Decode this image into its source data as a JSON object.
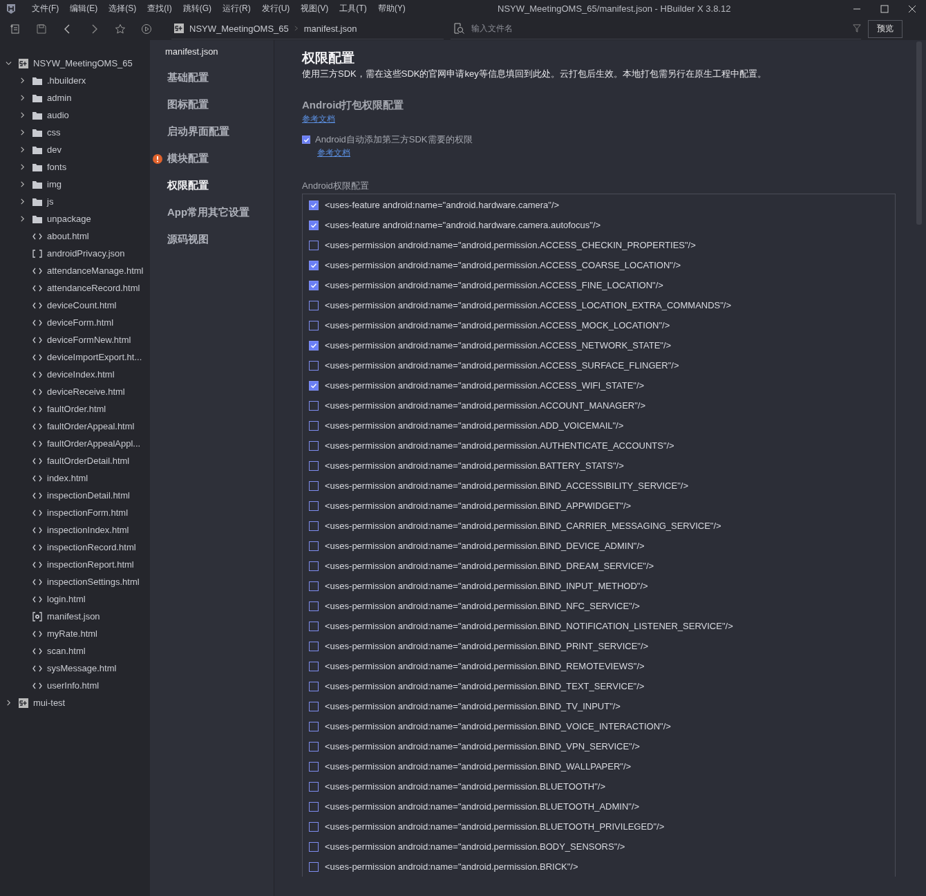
{
  "window": {
    "title": "NSYW_MeetingOMS_65/manifest.json - HBuilder X 3.8.12"
  },
  "menu": [
    "文件(F)",
    "编辑(E)",
    "选择(S)",
    "查找(I)",
    "跳转(G)",
    "运行(R)",
    "发行(U)",
    "视图(V)",
    "工具(T)",
    "帮助(Y)"
  ],
  "breadcrumb": [
    "NSYW_MeetingOMS_65",
    "manifest.json"
  ],
  "search": {
    "placeholder": "输入文件名"
  },
  "preview_button": "预览",
  "tree": [
    {
      "kind": "project",
      "name": "NSYW_MeetingOMS_65",
      "expanded": true,
      "children": [
        {
          "kind": "folder",
          "name": ".hbuilderx",
          "expanded": false
        },
        {
          "kind": "folder",
          "name": "admin",
          "expanded": false
        },
        {
          "kind": "folder",
          "name": "audio",
          "expanded": false
        },
        {
          "kind": "folder",
          "name": "css",
          "expanded": false
        },
        {
          "kind": "folder",
          "name": "dev",
          "expanded": false
        },
        {
          "kind": "folder",
          "name": "fonts",
          "expanded": false
        },
        {
          "kind": "folder",
          "name": "img",
          "expanded": false
        },
        {
          "kind": "folder",
          "name": "js",
          "expanded": false
        },
        {
          "kind": "folder",
          "name": "unpackage",
          "expanded": false
        },
        {
          "kind": "html",
          "name": "about.html"
        },
        {
          "kind": "json",
          "name": "androidPrivacy.json"
        },
        {
          "kind": "html",
          "name": "attendanceManage.html"
        },
        {
          "kind": "html",
          "name": "attendanceRecord.html"
        },
        {
          "kind": "html",
          "name": "deviceCount.html"
        },
        {
          "kind": "html",
          "name": "deviceForm.html"
        },
        {
          "kind": "html",
          "name": "deviceFormNew.html"
        },
        {
          "kind": "html",
          "name": "deviceImportExport.ht..."
        },
        {
          "kind": "html",
          "name": "deviceIndex.html"
        },
        {
          "kind": "html",
          "name": "deviceReceive.html"
        },
        {
          "kind": "html",
          "name": "faultOrder.html"
        },
        {
          "kind": "html",
          "name": "faultOrderAppeal.html"
        },
        {
          "kind": "html",
          "name": "faultOrderAppealAppl..."
        },
        {
          "kind": "html",
          "name": "faultOrderDetail.html"
        },
        {
          "kind": "html",
          "name": "index.html"
        },
        {
          "kind": "html",
          "name": "inspectionDetail.html"
        },
        {
          "kind": "html",
          "name": "inspectionForm.html"
        },
        {
          "kind": "html",
          "name": "inspectionIndex.html"
        },
        {
          "kind": "html",
          "name": "inspectionRecord.html"
        },
        {
          "kind": "html",
          "name": "inspectionReport.html"
        },
        {
          "kind": "html",
          "name": "inspectionSettings.html"
        },
        {
          "kind": "html",
          "name": "login.html"
        },
        {
          "kind": "manifest",
          "name": "manifest.json"
        },
        {
          "kind": "html",
          "name": "myRate.html"
        },
        {
          "kind": "html",
          "name": "scan.html"
        },
        {
          "kind": "html",
          "name": "sysMessage.html"
        },
        {
          "kind": "html",
          "name": "userInfo.html"
        }
      ]
    },
    {
      "kind": "project",
      "name": "mui-test",
      "expanded": false
    }
  ],
  "editor_tab": "manifest.json",
  "nav": [
    {
      "label": "基础配置",
      "selected": false,
      "warning": false
    },
    {
      "label": "图标配置",
      "selected": false,
      "warning": false
    },
    {
      "label": "启动界面配置",
      "selected": false,
      "warning": false
    },
    {
      "label": "模块配置",
      "selected": false,
      "warning": true
    },
    {
      "label": "权限配置",
      "selected": true,
      "warning": false
    },
    {
      "label": "App常用其它设置",
      "selected": false,
      "warning": false
    },
    {
      "label": "源码视图",
      "selected": false,
      "warning": false
    }
  ],
  "page": {
    "title": "权限配置",
    "description": "使用三方SDK，需在这些SDK的官网申请key等信息填回到此处。云打包后生效。本地打包需另行在原生工程中配置。",
    "section_title": "Android打包权限配置",
    "section_link": "参考文档",
    "auto_add": {
      "label": "Android自动添加第三方SDK需要的权限",
      "checked": true,
      "link": "参考文档"
    },
    "list_label": "Android权限配置",
    "permissions": [
      {
        "text": "<uses-feature android:name=\"android.hardware.camera\"/>",
        "checked": true
      },
      {
        "text": "<uses-feature android:name=\"android.hardware.camera.autofocus\"/>",
        "checked": true
      },
      {
        "text": "<uses-permission android:name=\"android.permission.ACCESS_CHECKIN_PROPERTIES\"/>",
        "checked": false
      },
      {
        "text": "<uses-permission android:name=\"android.permission.ACCESS_COARSE_LOCATION\"/>",
        "checked": true
      },
      {
        "text": "<uses-permission android:name=\"android.permission.ACCESS_FINE_LOCATION\"/>",
        "checked": true
      },
      {
        "text": "<uses-permission android:name=\"android.permission.ACCESS_LOCATION_EXTRA_COMMANDS\"/>",
        "checked": false
      },
      {
        "text": "<uses-permission android:name=\"android.permission.ACCESS_MOCK_LOCATION\"/>",
        "checked": false
      },
      {
        "text": "<uses-permission android:name=\"android.permission.ACCESS_NETWORK_STATE\"/>",
        "checked": true
      },
      {
        "text": "<uses-permission android:name=\"android.permission.ACCESS_SURFACE_FLINGER\"/>",
        "checked": false
      },
      {
        "text": "<uses-permission android:name=\"android.permission.ACCESS_WIFI_STATE\"/>",
        "checked": true
      },
      {
        "text": "<uses-permission android:name=\"android.permission.ACCOUNT_MANAGER\"/>",
        "checked": false
      },
      {
        "text": "<uses-permission android:name=\"android.permission.ADD_VOICEMAIL\"/>",
        "checked": false
      },
      {
        "text": "<uses-permission android:name=\"android.permission.AUTHENTICATE_ACCOUNTS\"/>",
        "checked": false
      },
      {
        "text": "<uses-permission android:name=\"android.permission.BATTERY_STATS\"/>",
        "checked": false
      },
      {
        "text": "<uses-permission android:name=\"android.permission.BIND_ACCESSIBILITY_SERVICE\"/>",
        "checked": false
      },
      {
        "text": "<uses-permission android:name=\"android.permission.BIND_APPWIDGET\"/>",
        "checked": false
      },
      {
        "text": "<uses-permission android:name=\"android.permission.BIND_CARRIER_MESSAGING_SERVICE\"/>",
        "checked": false
      },
      {
        "text": "<uses-permission android:name=\"android.permission.BIND_DEVICE_ADMIN\"/>",
        "checked": false
      },
      {
        "text": "<uses-permission android:name=\"android.permission.BIND_DREAM_SERVICE\"/>",
        "checked": false
      },
      {
        "text": "<uses-permission android:name=\"android.permission.BIND_INPUT_METHOD\"/>",
        "checked": false
      },
      {
        "text": "<uses-permission android:name=\"android.permission.BIND_NFC_SERVICE\"/>",
        "checked": false
      },
      {
        "text": "<uses-permission android:name=\"android.permission.BIND_NOTIFICATION_LISTENER_SERVICE\"/>",
        "checked": false
      },
      {
        "text": "<uses-permission android:name=\"android.permission.BIND_PRINT_SERVICE\"/>",
        "checked": false
      },
      {
        "text": "<uses-permission android:name=\"android.permission.BIND_REMOTEVIEWS\"/>",
        "checked": false
      },
      {
        "text": "<uses-permission android:name=\"android.permission.BIND_TEXT_SERVICE\"/>",
        "checked": false
      },
      {
        "text": "<uses-permission android:name=\"android.permission.BIND_TV_INPUT\"/>",
        "checked": false
      },
      {
        "text": "<uses-permission android:name=\"android.permission.BIND_VOICE_INTERACTION\"/>",
        "checked": false
      },
      {
        "text": "<uses-permission android:name=\"android.permission.BIND_VPN_SERVICE\"/>",
        "checked": false
      },
      {
        "text": "<uses-permission android:name=\"android.permission.BIND_WALLPAPER\"/>",
        "checked": false
      },
      {
        "text": "<uses-permission android:name=\"android.permission.BLUETOOTH\"/>",
        "checked": false
      },
      {
        "text": "<uses-permission android:name=\"android.permission.BLUETOOTH_ADMIN\"/>",
        "checked": false
      },
      {
        "text": "<uses-permission android:name=\"android.permission.BLUETOOTH_PRIVILEGED\"/>",
        "checked": false
      },
      {
        "text": "<uses-permission android:name=\"android.permission.BODY_SENSORS\"/>",
        "checked": false
      },
      {
        "text": "<uses-permission android:name=\"android.permission.BRICK\"/>",
        "checked": false
      }
    ]
  }
}
